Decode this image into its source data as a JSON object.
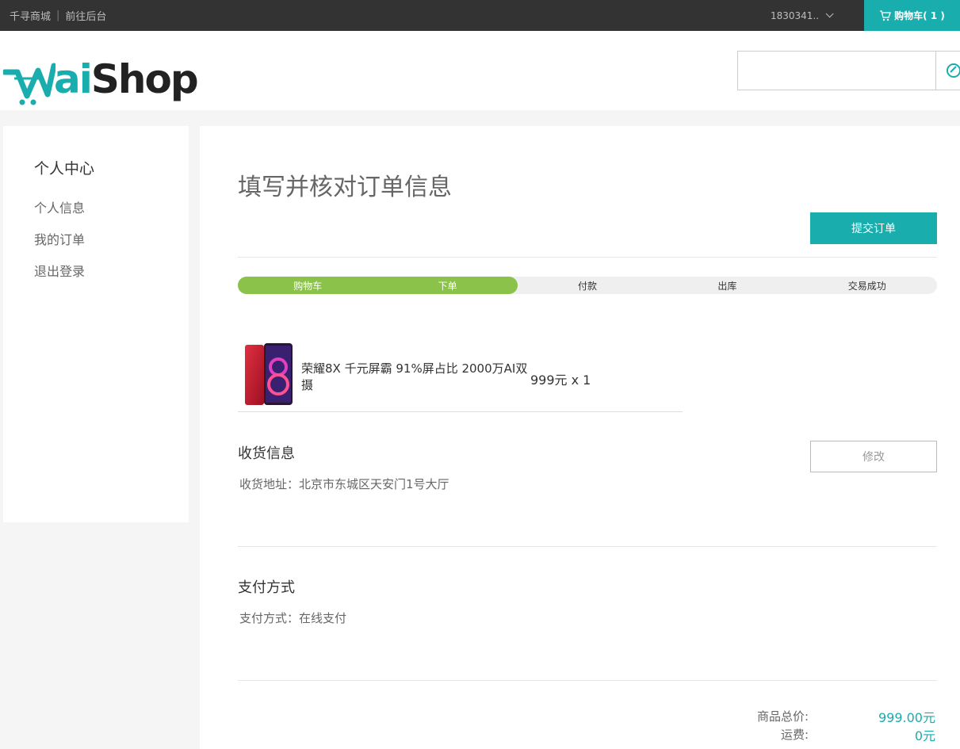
{
  "topbar": {
    "site_name": "千寻商城",
    "separator": "|",
    "admin_link": "前往后台",
    "username": "1830341..",
    "cart_label": "购物车( 1 )"
  },
  "header": {
    "logo_prefix": "W",
    "logo_ai": "ai",
    "logo_shop": "Shop",
    "search_placeholder": ""
  },
  "sidebar": {
    "title": "个人中心",
    "items": [
      {
        "label": "个人信息"
      },
      {
        "label": "我的订单"
      },
      {
        "label": "退出登录"
      }
    ]
  },
  "main": {
    "page_title": "填写并核对订单信息",
    "submit_label": "提交订单",
    "progress": {
      "steps": [
        "购物车",
        "下单",
        "付款",
        "出库",
        "交易成功"
      ],
      "completed_steps": 2
    },
    "product": {
      "name": "荣耀8X 千元屏霸 91%屏占比 2000万AI双摄",
      "price_qty": "999元 x 1"
    },
    "shipping": {
      "title": "收货信息",
      "address_line": "收货地址：北京市东城区天安门1号大厅",
      "modify_label": "修改"
    },
    "payment": {
      "title": "支付方式",
      "method_line": "支付方式：在线支付"
    },
    "summary": {
      "total_label": "商品总价:",
      "total_value": "999.00元",
      "shipping_label": "运费:",
      "shipping_value": "0元"
    }
  },
  "colors": {
    "accent": "#1aadae",
    "progress_done": "#8bc34a",
    "topbar_bg": "#333333"
  }
}
